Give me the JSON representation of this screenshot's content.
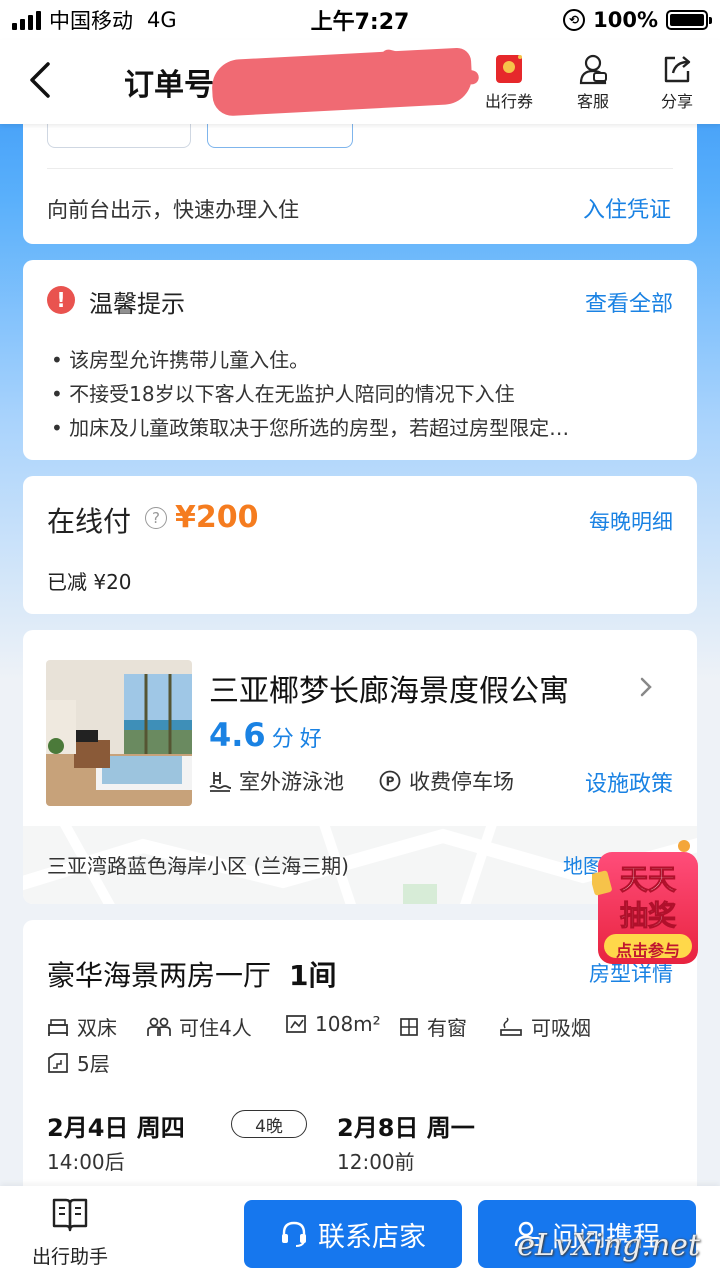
{
  "status_bar": {
    "carrier": "中国移动",
    "network": "4G",
    "time": "上午7:27",
    "battery": "100%"
  },
  "nav": {
    "title": "订单号",
    "actions": [
      {
        "label": "出行券",
        "icon": "red-envelope-icon"
      },
      {
        "label": "客服",
        "icon": "customer-service-icon"
      },
      {
        "label": "分享",
        "icon": "share-icon"
      }
    ]
  },
  "checkin_card": {
    "text": "向前台出示，快速办理入住",
    "link": "入住凭证"
  },
  "tips": {
    "title": "温馨提示",
    "link": "查看全部",
    "items": [
      "• 该房型允许携带儿童入住。",
      "• 不接受18岁以下客人在无监护人陪同的情况下入住",
      "• 加床及儿童政策取决于您所选的房型，若超过房型限定…"
    ]
  },
  "payment": {
    "label": "在线付",
    "amount": "¥200",
    "discount": "已减 ¥20",
    "link": "每晚明细"
  },
  "hotel": {
    "name": "三亚椰梦长廊海景度假公寓",
    "score": "4.6",
    "score_unit": "分",
    "score_word": "好",
    "amenity1": "室外游泳池",
    "amenity2": "收费停车场",
    "policy_link": "设施政策",
    "address": "三亚湾路蓝色海岸小区 (兰海三期)",
    "map_link": "地图"
  },
  "room": {
    "name": "豪华海景两房一厅",
    "count": "1间",
    "details_link": "房型详情",
    "features": [
      "双床",
      "可住4人",
      "108m²",
      "有窗",
      "可吸烟",
      "5层"
    ],
    "checkin_date": "2月4日 周四",
    "checkin_time": "14:00后",
    "nights": "4晚",
    "checkout_date": "2月8日 周一",
    "checkout_time": "12:00前"
  },
  "lottery": {
    "line1": "天天",
    "line2": "抽奖",
    "cta": "点击参与"
  },
  "bottom": {
    "assistant": "出行助手",
    "contact": "联系店家",
    "ask": "问问携程"
  },
  "watermark": "eLvXing.net",
  "colors": {
    "brand_blue": "#1677ee",
    "link_blue": "#1a82e3",
    "price_orange": "#f57c1f",
    "alert_red": "#e9534f"
  }
}
